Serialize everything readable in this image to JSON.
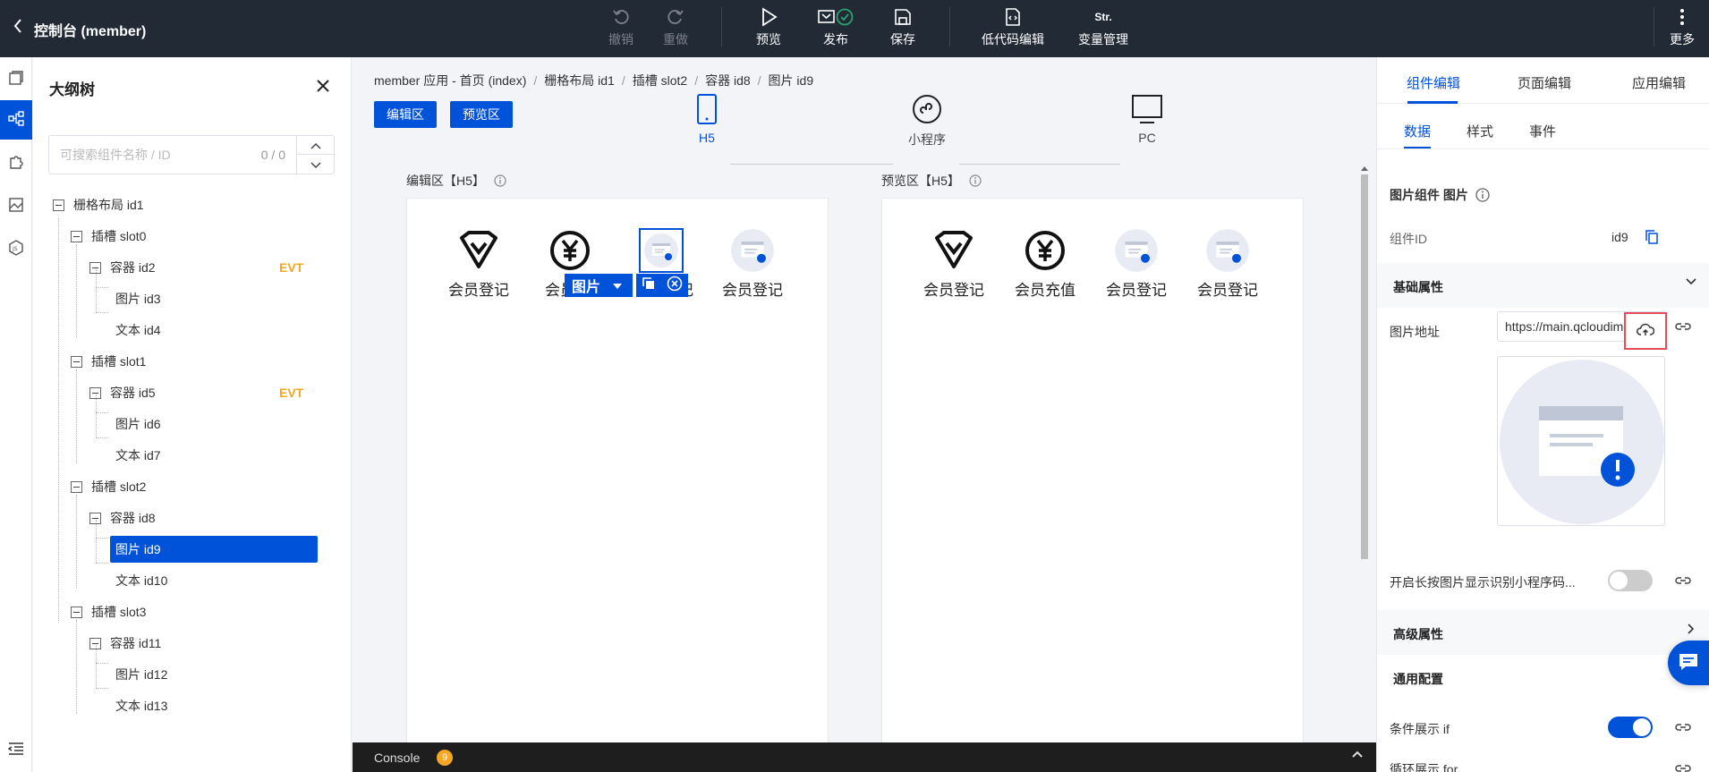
{
  "topbar": {
    "back_icon": "chevron-left-icon",
    "title": "控制台 (member)",
    "undo": "撤销",
    "redo": "重做",
    "preview": "预览",
    "publish": "发布",
    "save": "保存",
    "lowcode": "低代码编辑",
    "variable": "变量管理",
    "variable_icon_text": "Str.",
    "more": "更多"
  },
  "outline": {
    "title": "大纲树",
    "search_placeholder": "可搜索组件名称 / ID",
    "search_count": "0 / 0",
    "nodes": [
      {
        "label": "栅格布局 id1"
      },
      {
        "label": "插槽 slot0"
      },
      {
        "label": "容器 id2",
        "badge": "EVT"
      },
      {
        "label": "图片 id3"
      },
      {
        "label": "文本 id4"
      },
      {
        "label": "插槽 slot1"
      },
      {
        "label": "容器 id5",
        "badge": "EVT"
      },
      {
        "label": "图片 id6"
      },
      {
        "label": "文本 id7"
      },
      {
        "label": "插槽 slot2"
      },
      {
        "label": "容器 id8"
      },
      {
        "label": "图片 id9"
      },
      {
        "label": "文本 id10"
      },
      {
        "label": "插槽 slot3"
      },
      {
        "label": "容器 id11"
      },
      {
        "label": "图片 id12"
      },
      {
        "label": "文本 id13"
      }
    ]
  },
  "breadcrumb": [
    "member 应用 - 首页 (index)",
    "栅格布局 id1",
    "插槽 slot2",
    "容器 id8",
    "图片 id9"
  ],
  "zones": {
    "edit_btn": "编辑区",
    "preview_btn": "预览区",
    "edit_label": "编辑区【H5】",
    "preview_label": "预览区【H5】"
  },
  "devices": {
    "h5": "H5",
    "mini": "小程序",
    "pc": "PC"
  },
  "edit_items": [
    "会员登记",
    "会员",
    "记",
    "会员登记"
  ],
  "preview_items": [
    "会员登记",
    "会员充值",
    "会员登记",
    "会员登记"
  ],
  "selection_toolbar": {
    "label": "图片"
  },
  "console": {
    "label": "Console",
    "count": "9"
  },
  "right": {
    "tabs": [
      "组件编辑",
      "页面编辑",
      "应用编辑"
    ],
    "subtabs": [
      "数据",
      "样式",
      "事件"
    ],
    "component_title": "图片组件 图片",
    "component_id_label": "组件ID",
    "component_id_value": "id9",
    "basic_section": "基础属性",
    "img_url_label": "图片地址",
    "img_url_value": "https://main.qcloudimg",
    "longpress_label": "开启长按图片显示识别小程序码...",
    "advanced_section": "高级属性",
    "general_section": "通用配置",
    "cond_label": "条件展示 if",
    "loop_label": "循环展示 for"
  },
  "colors": {
    "accent": "#0052d9",
    "topbar": "#222a36",
    "evt": "#f5a623",
    "highlight": "#e34d59"
  }
}
